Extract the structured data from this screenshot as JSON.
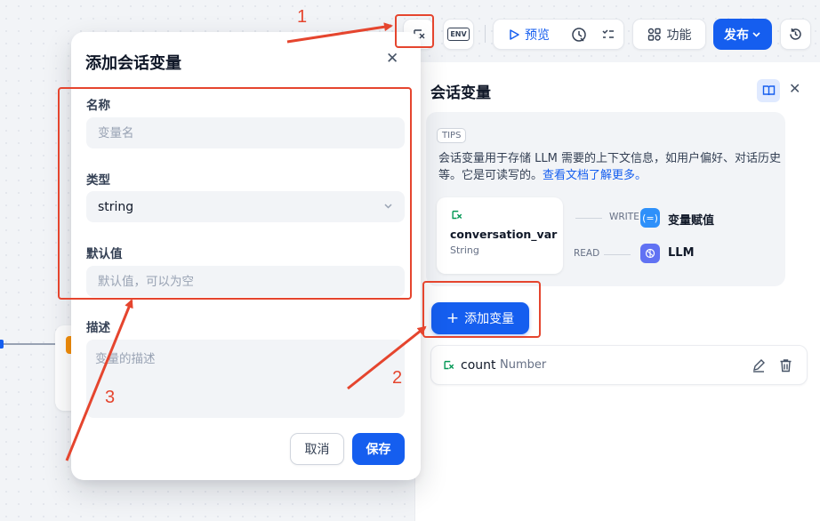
{
  "colors": {
    "primary": "#155eef",
    "annotation": "#e5452e",
    "text_muted": "#667085",
    "var_icon": "#039855"
  },
  "toolbar": {
    "preview_label": "预览",
    "features_label": "功能",
    "publish_label": "发布",
    "env_icon_text": "ENV"
  },
  "dialog": {
    "title": "添加会话变量",
    "name_label": "名称",
    "name_placeholder": "变量名",
    "type_label": "类型",
    "type_value": "string",
    "default_label": "默认值",
    "default_placeholder": "默认值，可以为空",
    "desc_label": "描述",
    "desc_placeholder": "变量的描述",
    "cancel_label": "取消",
    "save_label": "保存"
  },
  "panel": {
    "title": "会话变量",
    "tips_badge": "TIPS",
    "tips_text": "会话变量用于存储 LLM 需要的上下文信息，如用户偏好、对话历史等。它是可读写的。",
    "tips_link": "查看文档了解更多。",
    "diagram": {
      "var_name": "conversation_var",
      "var_type": "String",
      "write_label": "WRITE",
      "read_label": "READ",
      "assigner_label": "变量赋值",
      "llm_label": "LLM"
    },
    "add_button_label": "添加变量",
    "variables": [
      {
        "name": "count",
        "type": "Number"
      }
    ]
  },
  "annotations": {
    "label_1": "1",
    "label_2": "2",
    "label_3": "3"
  }
}
